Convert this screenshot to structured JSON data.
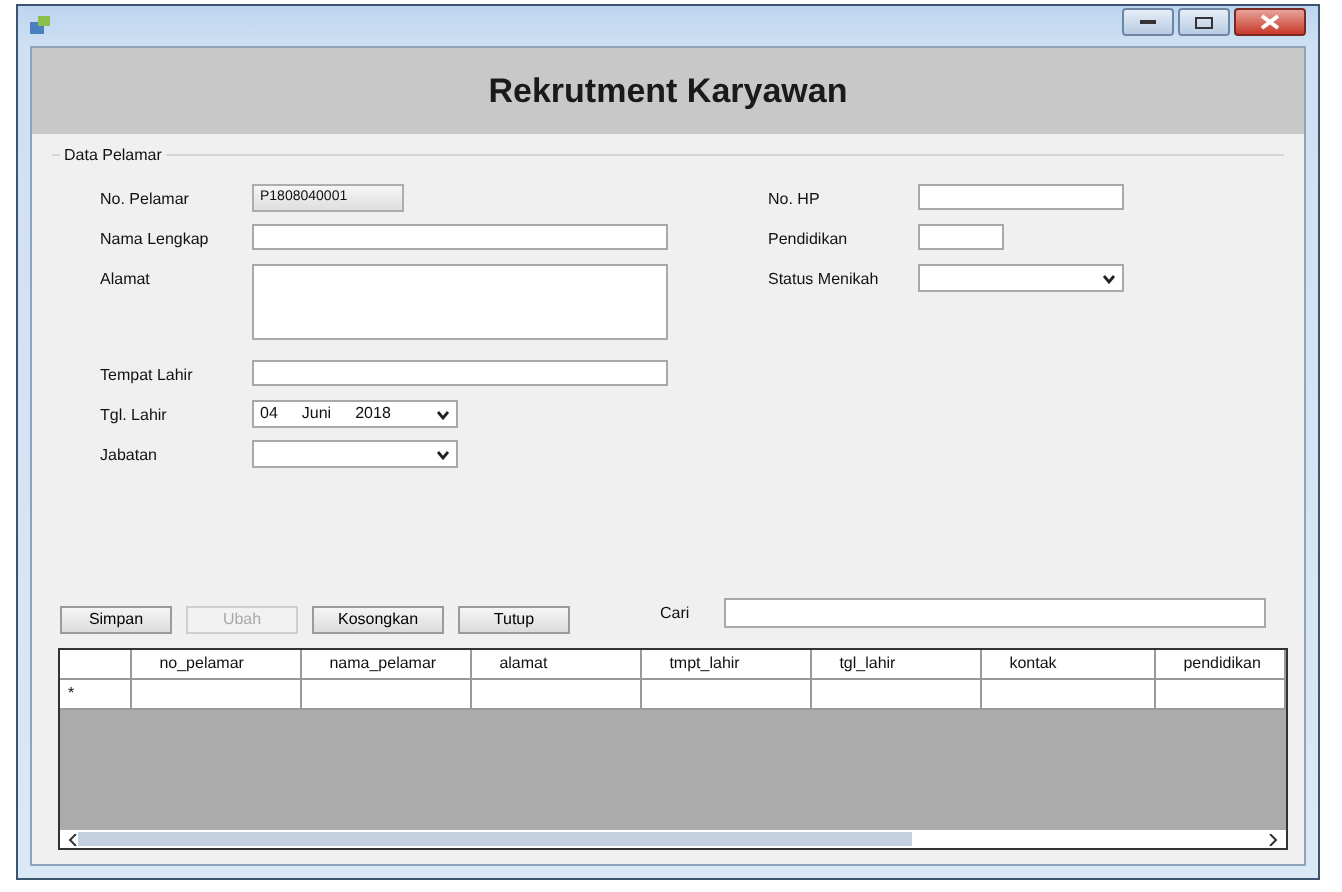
{
  "window": {
    "title": "Rekrutment Karyawan"
  },
  "group": {
    "legend": "Data Pelamar",
    "left_fields": [
      {
        "label": "No. Pelamar",
        "kind": "readonly",
        "value": "P1808040001"
      },
      {
        "label": "Nama Lengkap",
        "kind": "text"
      },
      {
        "label": "Alamat",
        "kind": "textarea"
      },
      {
        "label": "Tempat Lahir",
        "kind": "text"
      },
      {
        "label": "Tgl. Lahir",
        "kind": "date",
        "parts": [
          "04",
          "Juni",
          "2018"
        ]
      },
      {
        "label": "Jabatan",
        "kind": "combo"
      }
    ],
    "right_fields": [
      {
        "label": "No. HP",
        "kind": "text"
      },
      {
        "label": "Pendidikan",
        "kind": "short"
      },
      {
        "label": "Status Menikah",
        "kind": "combo"
      }
    ]
  },
  "buttons": [
    {
      "label": "Simpan",
      "disabled": false
    },
    {
      "label": "Ubah",
      "disabled": true
    },
    {
      "label": "Kosongkan",
      "disabled": false
    },
    {
      "label": "Tutup",
      "disabled": false
    }
  ],
  "search": {
    "label": "Cari"
  },
  "table": {
    "columns": [
      "no_pelamar",
      "nama_pelamar",
      "alamat",
      "tmpt_lahir",
      "tgl_lahir",
      "kontak",
      "pendidikan"
    ],
    "new_row_marker": "*"
  }
}
